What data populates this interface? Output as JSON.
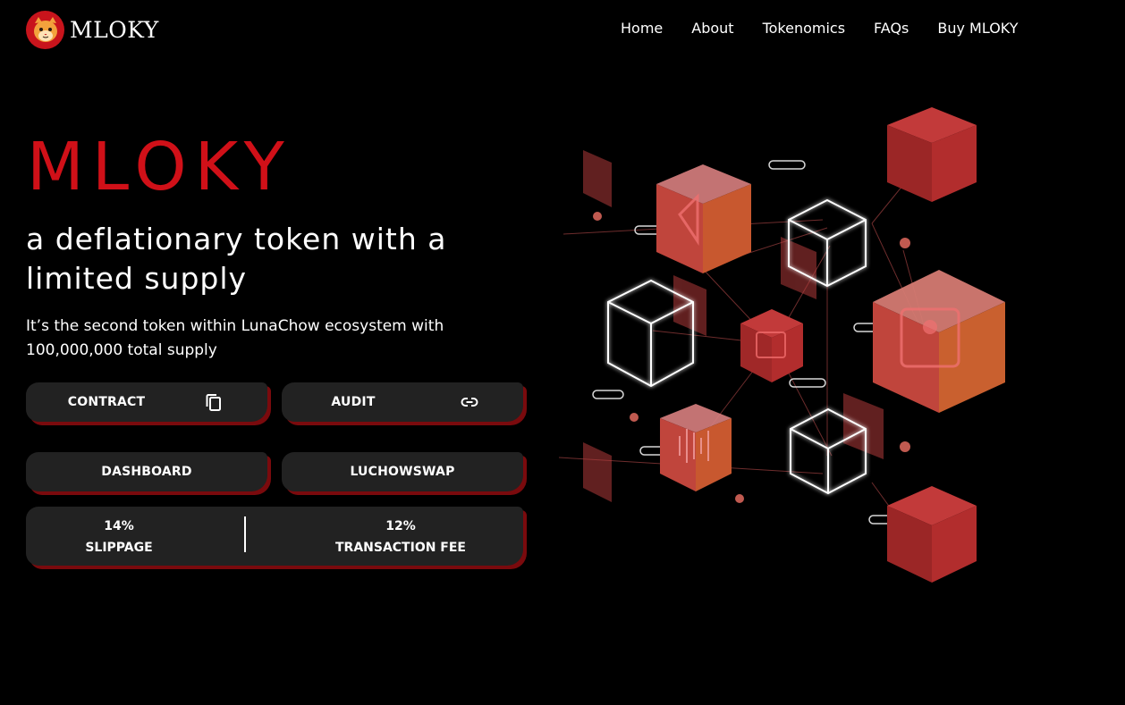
{
  "header": {
    "logo_text": "MLOKY",
    "nav": [
      {
        "label": "Home"
      },
      {
        "label": "About"
      },
      {
        "label": "Tokenomics"
      },
      {
        "label": "FAQs"
      },
      {
        "label": "Buy MLOKY"
      }
    ]
  },
  "hero": {
    "title": "MLOKY",
    "tagline": "a deflationary token with a limited supply",
    "description": "It’s the second token within LunaChow ecosystem with 100,000,000 total supply"
  },
  "buttons": {
    "contract": "CONTRACT",
    "audit": "AUDIT",
    "dashboard": "DASHBOARD",
    "swap": "LUCHOWSWAP"
  },
  "stats": {
    "slippage_value": "14%",
    "slippage_label": "SLIPPAGE",
    "fee_value": "12%",
    "fee_label": "TRANSACTION FEE"
  },
  "icons": {
    "logo": "cat-face-icon",
    "contract": "copy-icon",
    "audit": "link-icon",
    "illustration": "blockchain-cubes-illustration"
  },
  "colors": {
    "accent": "#d01018",
    "button_bg": "#222222",
    "button_shadow": "#7a0a0d",
    "background": "#000000"
  }
}
